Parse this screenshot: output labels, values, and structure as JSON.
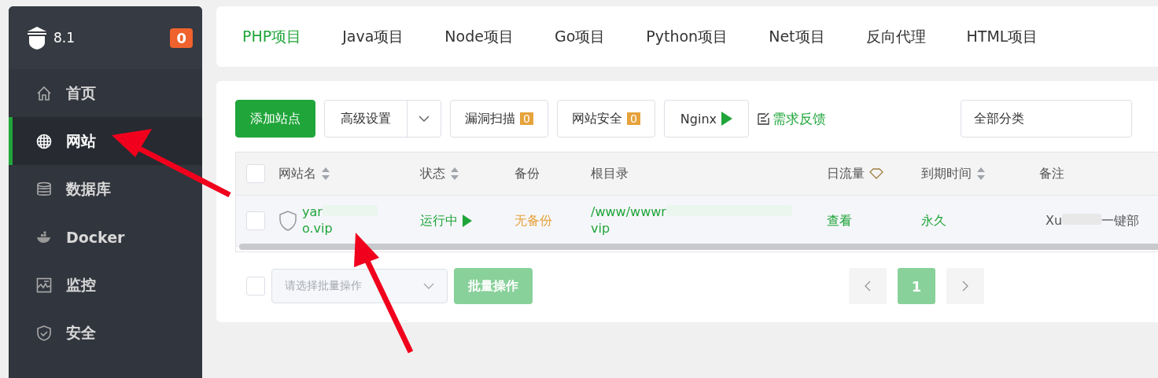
{
  "sidebar": {
    "server": "8.1",
    "badge": "0",
    "items": [
      {
        "kind": "home",
        "label": "首页",
        "selected": false
      },
      {
        "kind": "globe",
        "label": "网站",
        "selected": true
      },
      {
        "kind": "database",
        "label": "数据库",
        "selected": false
      },
      {
        "kind": "docker",
        "label": "Docker",
        "selected": false
      },
      {
        "kind": "monitor",
        "label": "监控",
        "selected": false
      },
      {
        "kind": "shield",
        "label": "安全",
        "selected": false
      }
    ]
  },
  "tabs": [
    {
      "label": "PHP项目",
      "selected": true
    },
    {
      "label": "Java项目",
      "selected": false
    },
    {
      "label": "Node项目",
      "selected": false
    },
    {
      "label": "Go项目",
      "selected": false
    },
    {
      "label": "Python项目",
      "selected": false
    },
    {
      "label": "Net项目",
      "selected": false
    },
    {
      "label": "反向代理",
      "selected": false
    },
    {
      "label": "HTML项目",
      "selected": false
    }
  ],
  "toolbar": {
    "add_site": "添加站点",
    "advanced": "高级设置",
    "scan": "漏洞扫描",
    "scan_count": "0",
    "security": "网站安全",
    "security_count": "0",
    "nginx": "Nginx",
    "feedback": "需求反馈",
    "category": "全部分类"
  },
  "table": {
    "all_checked": false,
    "columns": [
      {
        "label": "网站名",
        "sortable": true
      },
      {
        "label": "状态",
        "sortable": true
      },
      {
        "label": "备份",
        "sortable": false
      },
      {
        "label": "根目录",
        "sortable": false
      },
      {
        "label": "日流量",
        "sortable": false
      },
      {
        "label": "到期时间",
        "sortable": true
      },
      {
        "label": "备注",
        "sortable": false
      }
    ],
    "rows": [
      {
        "checked": false,
        "name": "yar",
        "name_end": "o.vip",
        "status": "运行中",
        "backup": "无备份",
        "root": "/www/wwwr",
        "root_end": "vip",
        "traffic": "查看",
        "expiry": "永久",
        "remark": "Xu",
        "remark_end": "一键部"
      }
    ]
  },
  "footer": {
    "checked": false,
    "batch_placeholder": "请选择批量操作",
    "batch_button": "批量操作",
    "page": "1"
  }
}
